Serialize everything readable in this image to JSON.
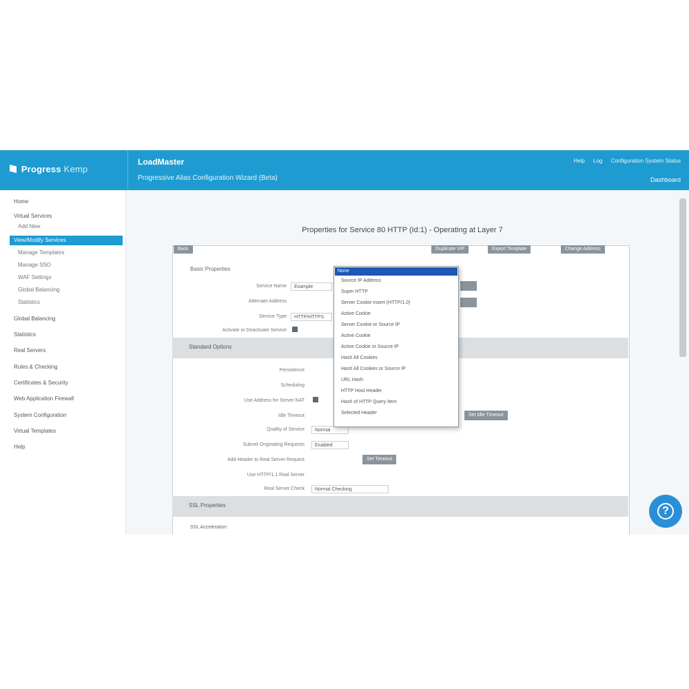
{
  "header": {
    "logo_text": "Progress",
    "logo_sub": "Kemp",
    "title": "LoadMaster",
    "subtitle": "Progressive Alias Configuration Wizard (Beta)",
    "links": [
      "Help",
      "Log",
      "Configuration System Status"
    ],
    "right_link": "Dashboard"
  },
  "sidebar": {
    "items": [
      {
        "label": "Home"
      },
      {
        "label": "Virtual Services"
      },
      {
        "label": "Add New",
        "sub": true
      },
      {
        "label": "View/Modify Services",
        "active": true
      },
      {
        "label": "Manage Templates",
        "sub": true
      },
      {
        "label": "Manage SSO",
        "sub": true
      },
      {
        "label": "WAF Settings",
        "sub": true
      },
      {
        "label": "Global Balancing",
        "sub": true
      },
      {
        "label": "Statistics",
        "sub": true
      },
      {
        "label": "Global Balancing"
      },
      {
        "label": "Statistics"
      },
      {
        "label": "Real Servers"
      },
      {
        "label": "Rules & Checking"
      },
      {
        "label": "Certificates & Security"
      },
      {
        "label": "Web Application Firewall"
      },
      {
        "label": "System Configuration"
      },
      {
        "label": "Virtual Templates"
      },
      {
        "label": "Help"
      }
    ]
  },
  "content": {
    "page_title": "Properties for Service 80 HTTP (Id:1) - Operating at Layer 7",
    "back_button": "Back",
    "top_buttons": [
      "Duplicate VIP",
      "Export Template",
      "Change Address"
    ],
    "basic_label": "Basic Properties",
    "form_rows": [
      {
        "label": "Service Name",
        "value": "Example"
      },
      {
        "label": "Alternate Address",
        "value": ""
      },
      {
        "label": "Service Type",
        "value": "HTTP/HTTPS"
      },
      {
        "label": "Activate or Deactivate Service",
        "value": ""
      }
    ],
    "standard_section": "Standard Options",
    "standard_rows": [
      {
        "label": "Persistence",
        "value": ""
      },
      {
        "label": "Scheduling",
        "value": ""
      },
      {
        "label": "Use Address for Server NAT",
        "value": ""
      },
      {
        "label": "Idle Timeout",
        "value": ""
      },
      {
        "label": "Quality of Service",
        "value": "Normal"
      },
      {
        "label": "Subnet Originating Requests",
        "value": "Enabled"
      },
      {
        "label": "Add Header to Real Server Request",
        "value": ""
      },
      {
        "label": "Use HTTP/1.1 Real Server",
        "value": ""
      },
      {
        "label": "Real Server Check",
        "value": "Normal Checking"
      }
    ],
    "set_button": "Set Idle Timeout",
    "set_button2": "Set Timeout",
    "ssl_section": "SSL Properties",
    "ssl_sub": "SSL Acceleration"
  },
  "dropdown": {
    "selected": "None",
    "options": [
      "Source IP Address",
      "Super HTTP",
      "Server Cookie Insert (HTTP/1.0)",
      "Active Cookie",
      "Server Cookie or Source IP",
      "Active Cookie",
      "Active Cookie or Source IP",
      "Hash All Cookies",
      "Hash All Cookies or Source IP",
      "URL Hash",
      "HTTP Host Header",
      "Hash of HTTP Query Item",
      "Selected Header"
    ]
  }
}
